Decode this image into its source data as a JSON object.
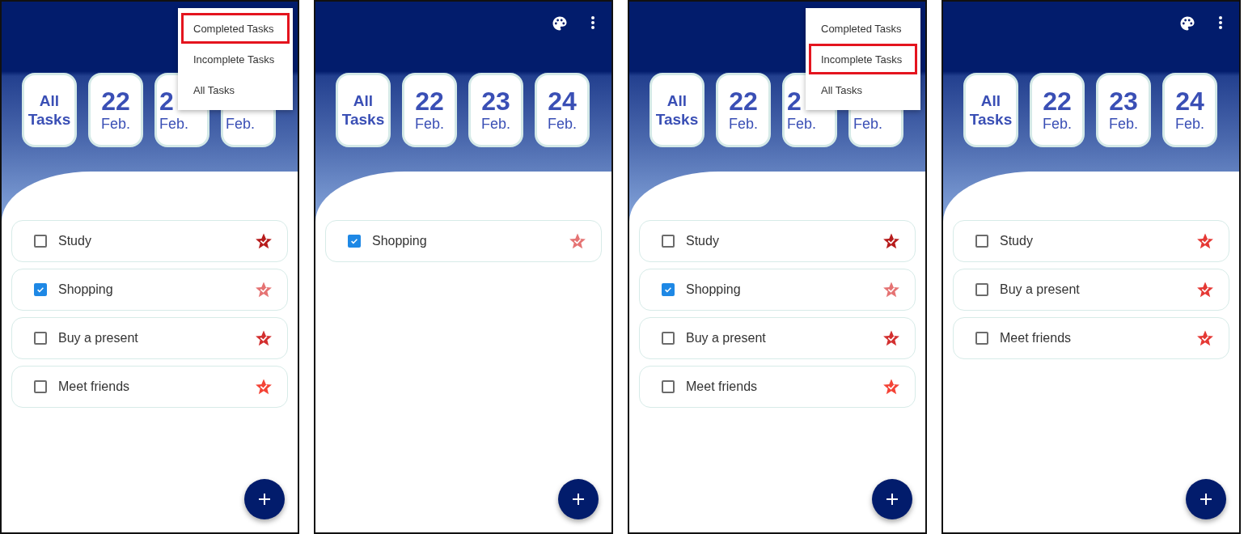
{
  "panels": [
    {
      "menu": {
        "items": [
          {
            "label": "Completed Tasks",
            "selected": true
          },
          {
            "label": "Incomplete Tasks",
            "selected": false
          },
          {
            "label": "All Tasks",
            "selected": false
          }
        ]
      },
      "filters": [
        {
          "kind": "all",
          "label": "All Tasks"
        },
        {
          "kind": "date",
          "day": "22",
          "month": "Feb."
        },
        {
          "kind": "date",
          "day": "2",
          "month": "Feb."
        },
        {
          "kind": "date",
          "month": "Feb."
        }
      ],
      "tasks": [
        {
          "title": "Study",
          "checked": false,
          "color": "#b71c1c"
        },
        {
          "title": "Shopping",
          "checked": true,
          "color": "#e57373"
        },
        {
          "title": "Buy a present",
          "checked": false,
          "color": "#d32f2f"
        },
        {
          "title": "Meet friends",
          "checked": false,
          "color": "#f44336"
        }
      ]
    },
    {
      "filters": [
        {
          "kind": "all",
          "label": "All Tasks"
        },
        {
          "kind": "date",
          "day": "22",
          "month": "Feb."
        },
        {
          "kind": "date",
          "day": "23",
          "month": "Feb."
        },
        {
          "kind": "date",
          "day": "24",
          "month": "Feb."
        }
      ],
      "tasks": [
        {
          "title": "Shopping",
          "checked": true,
          "color": "#e57373"
        }
      ]
    },
    {
      "menu": {
        "items": [
          {
            "label": "Completed Tasks",
            "selected": false
          },
          {
            "label": "Incomplete Tasks",
            "selected": true
          },
          {
            "label": "All Tasks",
            "selected": false
          }
        ]
      },
      "filters": [
        {
          "kind": "all",
          "label": "All Tasks"
        },
        {
          "kind": "date",
          "day": "22",
          "month": "Feb."
        },
        {
          "kind": "date",
          "day": "2",
          "month": "Feb."
        },
        {
          "kind": "date",
          "month": "Feb."
        }
      ],
      "tasks": [
        {
          "title": "Study",
          "checked": false,
          "color": "#b71c1c"
        },
        {
          "title": "Shopping",
          "checked": true,
          "color": "#e57373"
        },
        {
          "title": "Buy a present",
          "checked": false,
          "color": "#d32f2f"
        },
        {
          "title": "Meet friends",
          "checked": false,
          "color": "#f44336"
        }
      ]
    },
    {
      "filters": [
        {
          "kind": "all",
          "label": "All Tasks"
        },
        {
          "kind": "date",
          "day": "22",
          "month": "Feb."
        },
        {
          "kind": "date",
          "day": "23",
          "month": "Feb."
        },
        {
          "kind": "date",
          "day": "24",
          "month": "Feb."
        }
      ],
      "tasks": [
        {
          "title": "Study",
          "checked": false,
          "color": "#e53935"
        },
        {
          "title": "Buy a present",
          "checked": false,
          "color": "#e53935"
        },
        {
          "title": "Meet friends",
          "checked": false,
          "color": "#e53935"
        }
      ]
    }
  ]
}
